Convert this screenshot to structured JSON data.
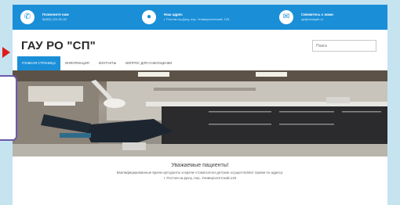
{
  "topbar": {
    "phone": {
      "icon": "phone-icon",
      "title": "Позвоните нам",
      "value": "8(863) 223-50-60"
    },
    "address": {
      "icon": "location-icon",
      "title": "Наш адрес",
      "value": "г. Ростов-на-Дону, пер. Университетский, 133"
    },
    "email": {
      "icon": "mail-icon",
      "title": "Свяжитесь с нами",
      "value": "sp@example.ru"
    }
  },
  "header": {
    "logo": "ГАУ РО \"СП\"",
    "search_placeholder": "Поиск"
  },
  "nav": {
    "items": [
      {
        "label": "Главная страница"
      },
      {
        "label": "Информация"
      },
      {
        "label": "Контакты"
      },
      {
        "label": "Вопрос для самооценки"
      }
    ]
  },
  "welcome": {
    "title": "Уважаемые пациенты!",
    "line1": "Квалифицированные врачи-ортодонты и врачи-стоматологи детские осуществляют прием по адресу:",
    "line2": "г. Ростов-на-Дону, пер. Университетский,133"
  },
  "colors": {
    "accent": "#1a8fd8",
    "pointer": "#e01b1b",
    "frame": "#c6e3f0"
  }
}
